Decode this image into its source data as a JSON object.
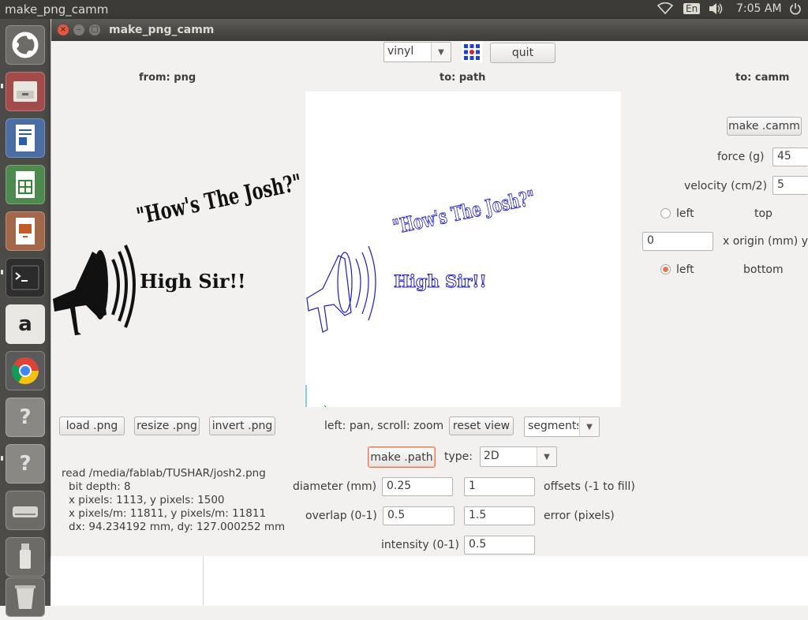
{
  "topbar": {
    "app_title": "make_png_camm",
    "lang": "En",
    "time": "7:05 AM",
    "icons": [
      "wifi-icon",
      "volume-icon",
      "power-icon"
    ]
  },
  "launcher": {
    "items": [
      "ubuntu-dash",
      "files",
      "writer",
      "calc",
      "impress",
      "terminal",
      "amazon",
      "chrome",
      "help",
      "help",
      "disk",
      "usb",
      "trash"
    ]
  },
  "window": {
    "title": "make_png_camm",
    "machine_select": "vinyl",
    "quit_label": "quit",
    "from_label": "from: png",
    "to_path_label": "to: path",
    "to_camm_label": "to: camm",
    "png_text_line1": "\"How's The Josh?\"",
    "png_text_line2": "High Sir!!",
    "path_text_line1": "\"How's The Josh?\"",
    "path_text_line2": "High Sir!!",
    "left_buttons": {
      "load": "load .png",
      "resize": "resize .png",
      "invert": "invert .png"
    },
    "view_hint": "left: pan, scroll: zoom",
    "reset_view_label": "reset view",
    "path_mode_select": "segments",
    "make_path_label": "make .path",
    "type_label": "type:",
    "type_select": "2D",
    "diameter_label": "diameter (mm)",
    "diameter_value": "0.25",
    "offsets_value": "1",
    "offsets_label": "offsets (-1 to fill)",
    "overlap_label": "overlap (0-1)",
    "overlap_value": "0.5",
    "error_value": "1.5",
    "error_label": "error (pixels)",
    "intensity_label": "intensity (0-1)",
    "intensity_value": "0.5",
    "info": {
      "line1": "read /media/fablab/TUSHAR/josh2.png",
      "line2": "bit depth: 8",
      "line3": "x pixels: 1113, y pixels: 1500",
      "line4": "x pixels/m: 11811, y pixels/m: 11811",
      "line5": "dx: 94.234192 mm, dy: 127.000252 mm"
    },
    "camm": {
      "make_label": "make .camm",
      "force_label": "force (g)",
      "force_value": "45",
      "velocity_label": "velocity (cm/2)",
      "velocity_value": "5",
      "radio1_left": "left",
      "radio1_top": "top",
      "origin_value": "0",
      "origin_label": "x  origin (mm)  y",
      "radio2_left": "left",
      "radio2_bottom": "bottom"
    }
  },
  "colors": {
    "path_stroke": "#1a1acc",
    "focus_orange": "#e9774e",
    "topbar_bg": "#3c3b37",
    "launcher_bg": "#4c4b47"
  }
}
